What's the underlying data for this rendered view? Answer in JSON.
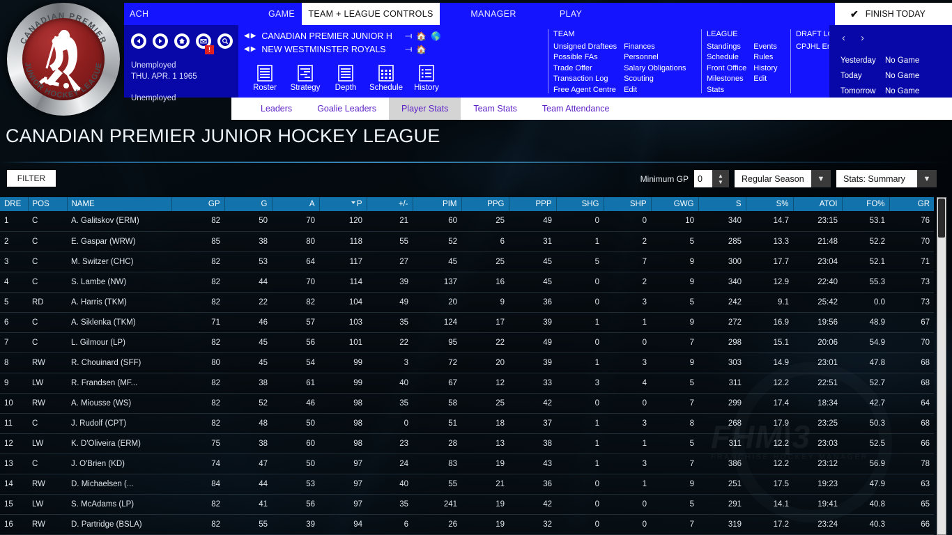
{
  "window": {
    "logo": {
      "top_text": "CANADIAN  PREMIER",
      "bottom_text": "JUNIOR HOCKEY LEAGUE",
      "icon": "hockey-player-logo"
    }
  },
  "menubar": {
    "items": [
      {
        "key": "ach",
        "label": "ACH",
        "active": false
      },
      {
        "key": "game",
        "label": "GAME",
        "active": false
      },
      {
        "key": "team_league",
        "label": "TEAM + LEAGUE CONTROLS",
        "active": true
      },
      {
        "key": "manager",
        "label": "MANAGER",
        "active": false
      },
      {
        "key": "play",
        "label": "PLAY",
        "active": false
      }
    ],
    "finish_button": {
      "label": "FINISH TODAY",
      "icon": "check-icon"
    }
  },
  "navpanel": {
    "icons": [
      {
        "name": "back-icon",
        "label": "Back"
      },
      {
        "name": "forward-icon",
        "label": "Forward"
      },
      {
        "name": "home-icon",
        "label": "Home"
      },
      {
        "name": "mail-icon",
        "label": "Inbox",
        "badge": "!"
      },
      {
        "name": "search-icon",
        "label": "Search"
      }
    ],
    "status_line1": "Unemployed",
    "status_line2": "THU. APR. 1 1965",
    "status_line3": "Unemployed",
    "league_row": {
      "name": "CANADIAN PREMIER JUNIOR H",
      "icons": [
        "chevron-double-down-icon",
        "home-icon",
        "globe-icon"
      ]
    },
    "team_row": {
      "name": "NEW WESTMINSTER ROYALS",
      "icons": [
        "chevron-double-down-icon",
        "home-icon"
      ]
    },
    "modules": [
      {
        "label": "Roster",
        "icon": "roster-icon"
      },
      {
        "label": "Strategy",
        "icon": "strategy-icon"
      },
      {
        "label": "Depth",
        "icon": "depth-icon"
      },
      {
        "label": "Schedule",
        "icon": "schedule-icon"
      },
      {
        "label": "History",
        "icon": "history-icon"
      }
    ],
    "link_groups": [
      {
        "header": "TEAM",
        "col1": [
          "Unsigned Draftees",
          "Possible FAs",
          "Trade Offer",
          "Transaction Log",
          "Free Agent Centre"
        ],
        "col2": [
          "Finances",
          "Personnel",
          "Salary Obligations",
          "Scouting",
          "Edit"
        ]
      },
      {
        "header": "LEAGUE",
        "col1": [
          "Standings",
          "Schedule",
          "Front Office",
          "Milestones",
          "Stats"
        ],
        "col2": [
          "Events",
          "Rules",
          "History",
          "Edit"
        ]
      },
      {
        "header": "DRAFT LOGS",
        "col1": [
          "CPJHL Entry Draft Log"
        ],
        "col2": []
      }
    ]
  },
  "daypanel": {
    "prev_icon": "chevron-left-icon",
    "next_icon": "chevron-right-icon",
    "rows": [
      {
        "day": "Yesterday",
        "game": "No Game"
      },
      {
        "day": "Today",
        "game": "No Game"
      },
      {
        "day": "Tomorrow",
        "game": "No Game"
      }
    ]
  },
  "tabs": [
    {
      "label": "Leaders",
      "active": false
    },
    {
      "label": "Goalie Leaders",
      "active": false
    },
    {
      "label": "Player Stats",
      "active": true
    },
    {
      "label": "Team Stats",
      "active": false
    },
    {
      "label": "Team Attendance",
      "active": false
    }
  ],
  "page_title": "CANADIAN PREMIER JUNIOR HOCKEY LEAGUE",
  "filterbar": {
    "filter_label": "FILTER",
    "minimum_gp_label": "Minimum GP",
    "minimum_gp_value": "0",
    "season_select": {
      "value": "Regular Season",
      "icon": "chevron-down-icon"
    },
    "stats_select": {
      "value": "Stats: Summary",
      "icon": "chevron-down-icon"
    }
  },
  "colors": {
    "menu_blue": "#1414ff",
    "panel_navy": "#0808a8",
    "header_blue": "#1272ab",
    "tab_purple": "#5b1fc7",
    "badge_red": "#e02020"
  },
  "chart_data": {
    "type": "table",
    "title": "Player Stats",
    "sorted_by": "P",
    "sort_direction": "desc",
    "columns": [
      "DRE",
      "POS",
      "NAME",
      "GP",
      "G",
      "A",
      "P",
      "+/-",
      "PIM",
      "PPG",
      "PPP",
      "SHG",
      "SHP",
      "GWG",
      "S",
      "S%",
      "ATOI",
      "FO%",
      "GR"
    ],
    "rows": [
      [
        "1",
        "C",
        "A. Galitskov  (ERM)",
        "82",
        "50",
        "70",
        "120",
        "21",
        "60",
        "25",
        "49",
        "0",
        "0",
        "10",
        "340",
        "14.7",
        "23:15",
        "53.1",
        "76"
      ],
      [
        "2",
        "C",
        "E. Gaspar  (WRW)",
        "85",
        "38",
        "80",
        "118",
        "55",
        "52",
        "6",
        "31",
        "1",
        "2",
        "5",
        "285",
        "13.3",
        "21:48",
        "52.2",
        "70"
      ],
      [
        "3",
        "C",
        "M. Switzer  (CHC)",
        "82",
        "53",
        "64",
        "117",
        "27",
        "45",
        "25",
        "45",
        "5",
        "7",
        "9",
        "300",
        "17.7",
        "23:04",
        "52.1",
        "71"
      ],
      [
        "4",
        "C",
        "S. Lambe  (NW)",
        "82",
        "44",
        "70",
        "114",
        "39",
        "137",
        "16",
        "45",
        "0",
        "2",
        "9",
        "340",
        "12.9",
        "22:40",
        "55.3",
        "73"
      ],
      [
        "5",
        "RD",
        "A. Harris  (TKM)",
        "82",
        "22",
        "82",
        "104",
        "49",
        "20",
        "9",
        "36",
        "0",
        "3",
        "5",
        "242",
        "9.1",
        "25:42",
        "0.0",
        "73"
      ],
      [
        "6",
        "C",
        "A. Siklenka  (TKM)",
        "71",
        "46",
        "57",
        "103",
        "35",
        "124",
        "17",
        "39",
        "1",
        "1",
        "9",
        "272",
        "16.9",
        "19:56",
        "48.9",
        "67"
      ],
      [
        "7",
        "C",
        "L. Gilmour  (LP)",
        "82",
        "45",
        "56",
        "101",
        "22",
        "95",
        "22",
        "49",
        "0",
        "0",
        "7",
        "298",
        "15.1",
        "20:06",
        "54.9",
        "70"
      ],
      [
        "8",
        "RW",
        "R. Chouinard  (SFF)",
        "80",
        "45",
        "54",
        "99",
        "3",
        "72",
        "20",
        "39",
        "1",
        "3",
        "9",
        "303",
        "14.9",
        "23:01",
        "47.8",
        "68"
      ],
      [
        "9",
        "LW",
        "R. Frandsen  (MF...",
        "82",
        "38",
        "61",
        "99",
        "40",
        "67",
        "12",
        "33",
        "3",
        "4",
        "5",
        "311",
        "12.2",
        "22:51",
        "52.7",
        "68"
      ],
      [
        "10",
        "RW",
        "A. Miousse  (WS)",
        "82",
        "52",
        "46",
        "98",
        "35",
        "58",
        "25",
        "42",
        "0",
        "0",
        "7",
        "299",
        "17.4",
        "18:34",
        "42.7",
        "64"
      ],
      [
        "11",
        "C",
        "J. Rudolf  (CPT)",
        "82",
        "48",
        "50",
        "98",
        "0",
        "51",
        "18",
        "37",
        "1",
        "3",
        "8",
        "268",
        "17.9",
        "23:25",
        "50.3",
        "68"
      ],
      [
        "12",
        "LW",
        "K. D'Oliveira  (ERM)",
        "75",
        "38",
        "60",
        "98",
        "23",
        "28",
        "13",
        "38",
        "1",
        "1",
        "5",
        "311",
        "12.2",
        "23:03",
        "52.5",
        "66"
      ],
      [
        "13",
        "C",
        "J. O'Brien  (KD)",
        "74",
        "47",
        "50",
        "97",
        "24",
        "83",
        "19",
        "43",
        "1",
        "3",
        "7",
        "386",
        "12.2",
        "23:12",
        "56.9",
        "78"
      ],
      [
        "14",
        "RW",
        "D. Michaelsen  (...",
        "84",
        "44",
        "53",
        "97",
        "40",
        "55",
        "21",
        "36",
        "0",
        "1",
        "9",
        "251",
        "17.5",
        "19:23",
        "47.9",
        "63"
      ],
      [
        "15",
        "LW",
        "S. McAdams  (LP)",
        "82",
        "41",
        "56",
        "97",
        "35",
        "241",
        "19",
        "42",
        "0",
        "0",
        "5",
        "291",
        "14.1",
        "19:41",
        "40.8",
        "65"
      ],
      [
        "16",
        "RW",
        "D. Partridge  (BSLA)",
        "82",
        "55",
        "39",
        "94",
        "6",
        "26",
        "19",
        "32",
        "0",
        "0",
        "7",
        "319",
        "17.2",
        "23:24",
        "40.3",
        "66"
      ]
    ]
  },
  "watermark": {
    "text": "FHM|3",
    "subtext": "FRANCHISE HOCKEY MANAGER"
  }
}
